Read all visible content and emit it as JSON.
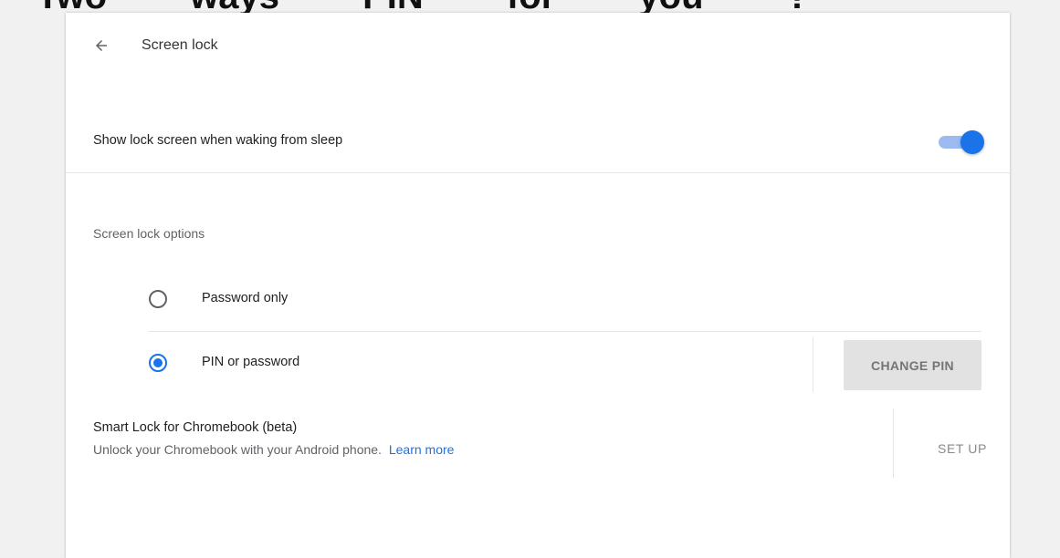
{
  "cropped_heading": [
    "Two",
    "ways",
    "PIN",
    "for",
    "you",
    "?"
  ],
  "header": {
    "back_icon": "arrow-left-icon",
    "title": "Screen lock"
  },
  "sleep_row": {
    "label": "Show lock screen when waking from sleep",
    "toggle_on": true
  },
  "lock_options": {
    "section_label": "Screen lock options",
    "options": [
      {
        "label": "Password only",
        "selected": false
      },
      {
        "label": "PIN or password",
        "selected": true
      }
    ],
    "change_pin_label": "CHANGE PIN"
  },
  "smart_lock": {
    "title": "Smart Lock for Chromebook (beta)",
    "subtitle": "Unlock your Chromebook with your Android phone.",
    "learn_more": "Learn more",
    "setup_label": "SET UP"
  },
  "colors": {
    "accent": "#1a73e8",
    "toggle_track": "#9dbbf1",
    "background": "#f1f1f1",
    "card": "#ffffff"
  }
}
